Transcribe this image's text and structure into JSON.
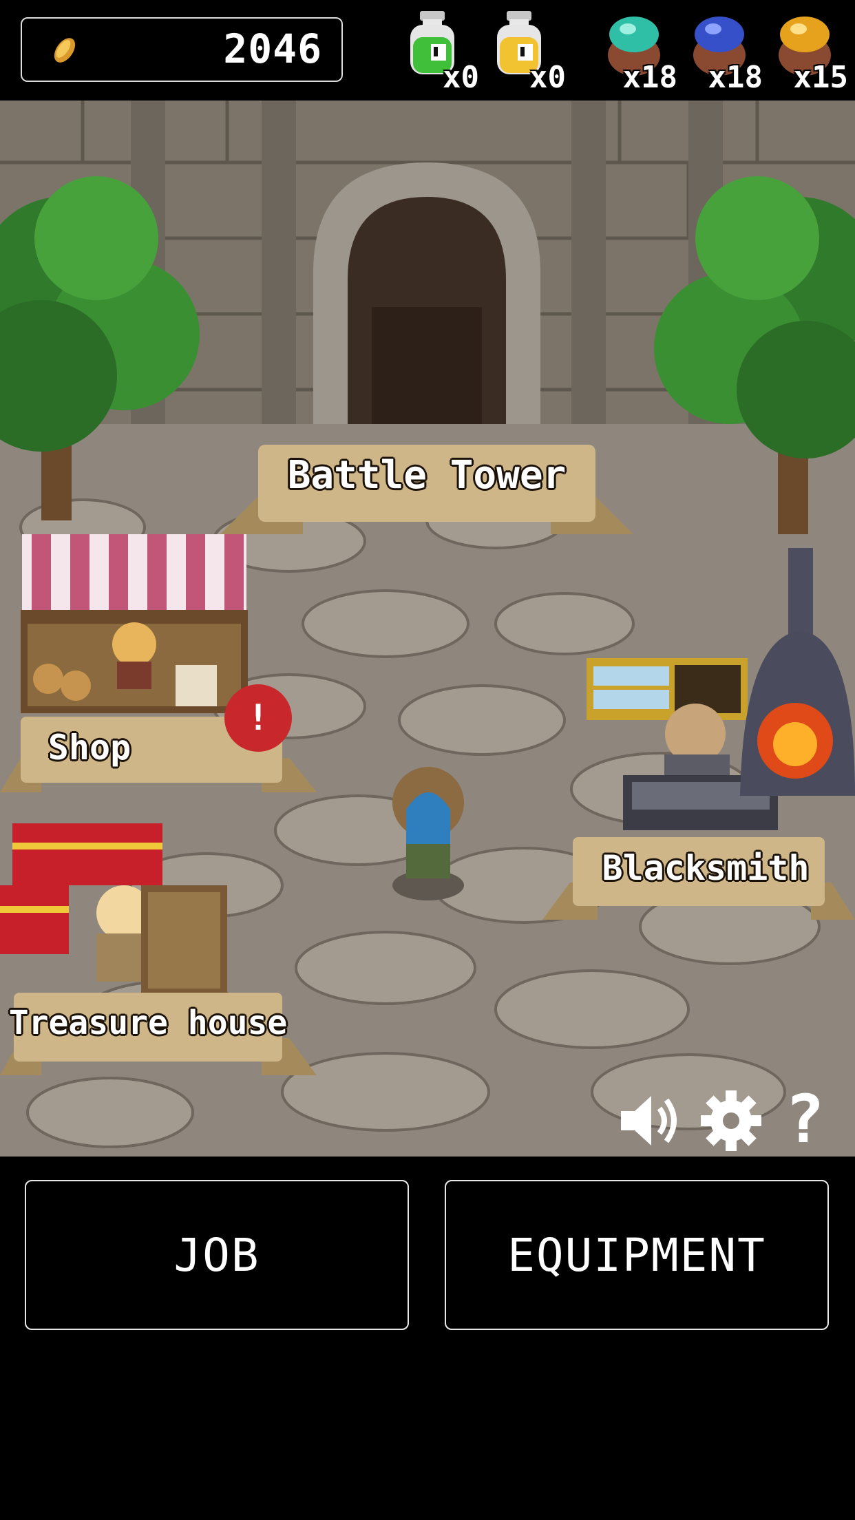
{
  "hud": {
    "gold": "2046",
    "items": [
      {
        "icon": "green-potion-icon",
        "count": "x0",
        "color": "#3fbf3a"
      },
      {
        "icon": "yellow-potion-icon",
        "count": "x0",
        "color": "#f2c330"
      },
      {
        "icon": "teal-gem-icon",
        "count": "x18",
        "color": "#2fbfa7"
      },
      {
        "icon": "blue-gem-icon",
        "count": "x18",
        "color": "#3550c8"
      },
      {
        "icon": "gold-gem-icon",
        "count": "x15",
        "color": "#e6a21c"
      }
    ]
  },
  "locations": {
    "battle_tower": "Battle Tower",
    "shop": "Shop",
    "blacksmith": "Blacksmith",
    "treasure_house": "Treasure house"
  },
  "shop_alert": "!",
  "controls": {
    "sound": "speaker-icon",
    "settings": "gear-icon",
    "help": "?"
  },
  "buttons": {
    "job": "JOB",
    "equipment": "EQUIPMENT"
  },
  "colors": {
    "banner": "#cfb688",
    "alert": "#c8282c",
    "ground": "#8f877e",
    "wall": "#7c7468"
  }
}
